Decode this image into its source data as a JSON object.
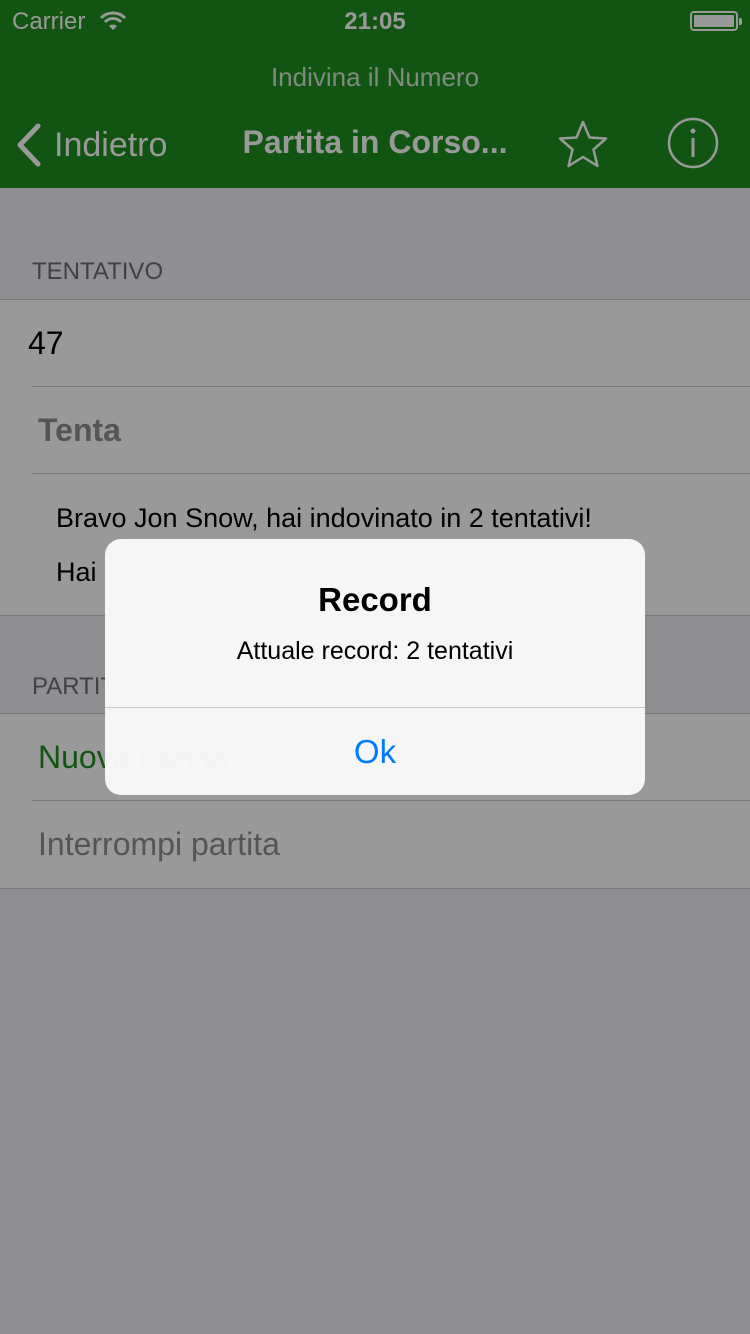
{
  "status_bar": {
    "carrier": "Carrier",
    "time": "21:05"
  },
  "nav": {
    "prompt": "Indivina il Numero",
    "back_label": "Indietro",
    "title": "Partita in Corso..."
  },
  "sections": {
    "attempt_header": "TENTATIVO",
    "game_header": "PARTITA"
  },
  "attempt": {
    "value": "47",
    "try_label": "Tenta",
    "message_line1": "Bravo Jon Snow, hai indovinato in 2 tentativi!",
    "message_line2": "Hai"
  },
  "game": {
    "new_game": "Nuova partita",
    "stop_game": "Interrompi partita"
  },
  "alert": {
    "title": "Record",
    "message": "Attuale record: 2 tentativi",
    "ok_label": "Ok"
  },
  "colors": {
    "nav_green": "#1f8c1f",
    "ios_blue": "#007aff"
  }
}
